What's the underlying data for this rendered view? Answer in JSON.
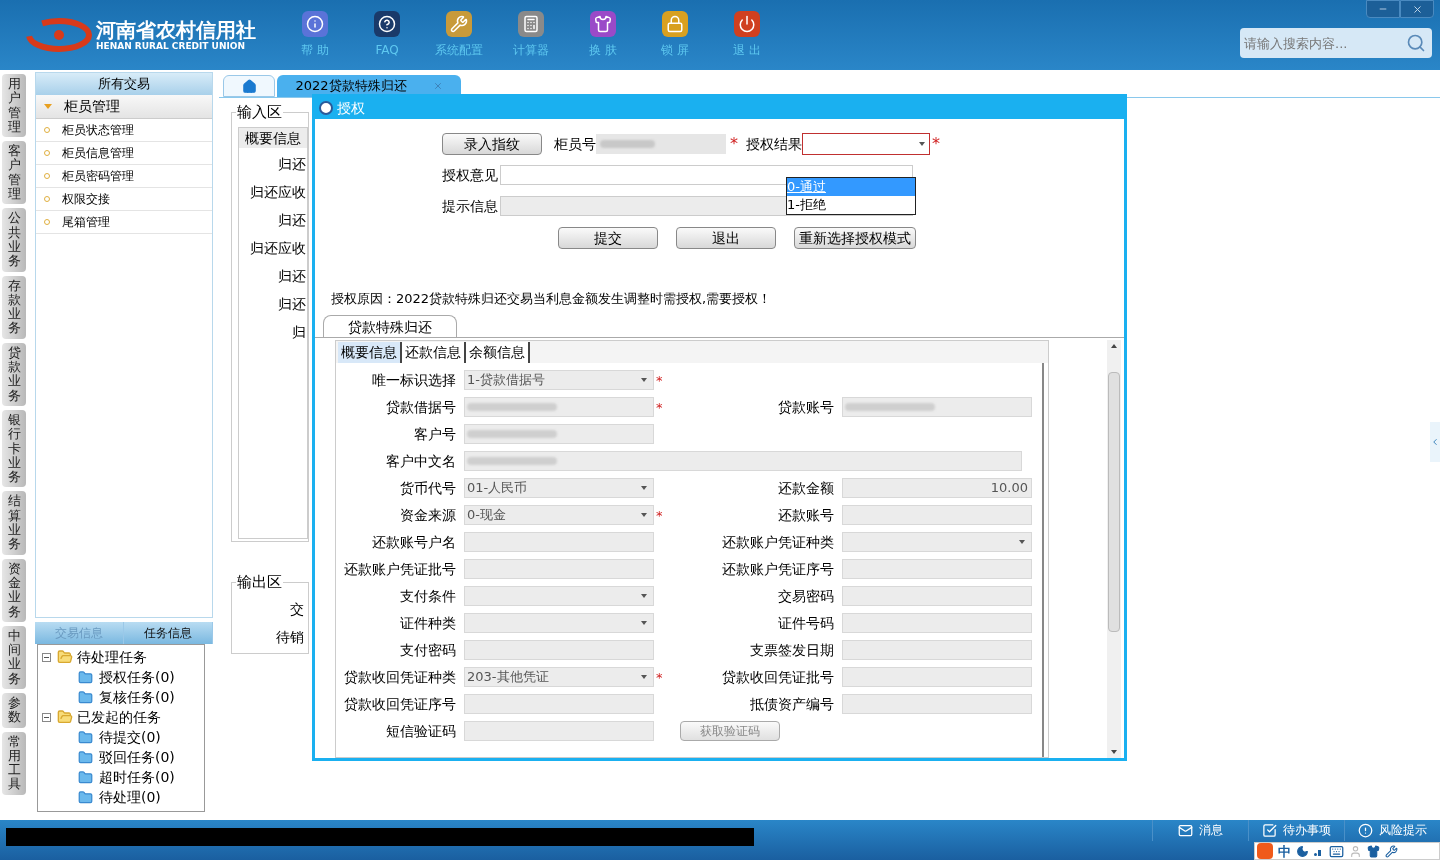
{
  "header": {
    "logo_title": "河南省农村信用社",
    "logo_subtitle": "HENAN RURAL CREDIT UNION",
    "nav": [
      {
        "label": "帮 助",
        "kind": "info"
      },
      {
        "label": "FAQ",
        "kind": "help"
      },
      {
        "label": "系统配置",
        "kind": "tools"
      },
      {
        "label": "计算器",
        "kind": "calculator"
      },
      {
        "label": "换 肤",
        "kind": "shirt"
      },
      {
        "label": "锁 屏",
        "kind": "lock"
      },
      {
        "label": "退 出",
        "kind": "power"
      }
    ],
    "search": {
      "placeholder": "请输入搜索内容..."
    }
  },
  "side_tabs": [
    "用户管理",
    "客户管理",
    "公共业务",
    "存款业务",
    "贷款业务",
    "银行卡业务",
    "结算业务",
    "资金业务",
    "中间业务",
    "参数",
    "常用工具"
  ],
  "left_panel": {
    "title": "所有交易",
    "group": {
      "label": "柜员管理",
      "expanded": true,
      "items": [
        "柜员状态管理",
        "柜员信息管理",
        "柜员密码管理",
        "权限交接",
        "尾箱管理"
      ]
    },
    "bottom_tabs": [
      {
        "label": "交易信息",
        "selected": false
      },
      {
        "label": "任务信息",
        "selected": true
      }
    ],
    "task_tree": [
      {
        "label": "待处理任务",
        "expanded": true,
        "children": [
          {
            "label": "授权任务(0)"
          },
          {
            "label": "复核任务(0)"
          }
        ]
      },
      {
        "label": "已发起的任务",
        "expanded": true,
        "children": [
          {
            "label": "待提交(0)"
          },
          {
            "label": "驳回任务(0)"
          },
          {
            "label": "超时任务(0)"
          },
          {
            "label": "待处理(0)"
          }
        ]
      }
    ]
  },
  "main": {
    "tabs": [
      {
        "kind": "home",
        "selected": false
      },
      {
        "kind": "text",
        "label": "2022贷款特殊归还",
        "selected": true
      }
    ],
    "input_area": {
      "title": "输入区",
      "tab": "概要信息",
      "labels": [
        "归还",
        "归还应收",
        "归还",
        "归还应收",
        "归还",
        "归还",
        "归"
      ]
    },
    "output_area": {
      "title": "输出区",
      "labels": [
        "交",
        "待销"
      ]
    }
  },
  "dialog": {
    "title": "授权",
    "required_mark": "*",
    "fingerprint_button": "录入指纹",
    "teller_label": "柜员号",
    "result_label": "授权结果",
    "result_expanded": true,
    "result_options": [
      {
        "label": "0-通过",
        "selected": true
      },
      {
        "label": "1-拒绝",
        "selected": false
      }
    ],
    "opinion_label": "授权意见",
    "hint_label": "提示信息",
    "buttons": [
      "提交",
      "退出",
      "重新选择授权模式"
    ],
    "reason": "授权原因：2022贷款特殊归还交易当利息金额发生调整时需授权,需要授权！",
    "section_tab": "贷款特殊归还",
    "subtabs": [
      {
        "label": "概要信息",
        "selected": true
      },
      {
        "label": "还款信息",
        "selected": false
      },
      {
        "label": "余额信息",
        "selected": false
      }
    ],
    "rows": [
      [
        {
          "label": "唯一标识选择",
          "kind": "select",
          "value": "1-贷款借据号",
          "required": true
        }
      ],
      [
        {
          "label": "贷款借据号",
          "kind": "text",
          "redacted": true,
          "required": true
        },
        {
          "label": "贷款账号",
          "kind": "text",
          "redacted": true
        }
      ],
      [
        {
          "label": "客户号",
          "kind": "text",
          "redacted": true
        }
      ],
      [
        {
          "label": "客户中文名",
          "kind": "wide",
          "redacted": true
        }
      ],
      [
        {
          "label": "货币代号",
          "kind": "select",
          "value": "01-人民币"
        },
        {
          "label": "还款金额",
          "kind": "number",
          "value": "10.00"
        }
      ],
      [
        {
          "label": "资金来源",
          "kind": "select",
          "value": "0-现金",
          "required": true
        },
        {
          "label": "还款账号",
          "kind": "text"
        }
      ],
      [
        {
          "label": "还款账号户名",
          "kind": "text"
        },
        {
          "label": "还款账户凭证种类",
          "kind": "select"
        }
      ],
      [
        {
          "label": "还款账户凭证批号",
          "kind": "text"
        },
        {
          "label": "还款账户凭证序号",
          "kind": "text"
        }
      ],
      [
        {
          "label": "支付条件",
          "kind": "select"
        },
        {
          "label": "交易密码",
          "kind": "text"
        }
      ],
      [
        {
          "label": "证件种类",
          "kind": "select"
        },
        {
          "label": "证件号码",
          "kind": "text"
        }
      ],
      [
        {
          "label": "支付密码",
          "kind": "text"
        },
        {
          "label": "支票签发日期",
          "kind": "text"
        }
      ],
      [
        {
          "label": "贷款收回凭证种类",
          "kind": "select",
          "value": "203-其他凭证",
          "required": true
        },
        {
          "label": "贷款收回凭证批号",
          "kind": "text"
        }
      ],
      [
        {
          "label": "贷款收回凭证序号",
          "kind": "text"
        },
        {
          "label": "抵债资产编号",
          "kind": "text"
        }
      ],
      [
        {
          "label": "短信验证码",
          "kind": "text"
        },
        {
          "kind": "button",
          "label": "获取验证码"
        }
      ]
    ]
  },
  "status_bar": {
    "items": [
      {
        "label": "消息",
        "kind": "mail"
      },
      {
        "label": "待办事项",
        "kind": "check"
      },
      {
        "label": "风险提示",
        "kind": "alert"
      }
    ],
    "ime_label": "中"
  }
}
